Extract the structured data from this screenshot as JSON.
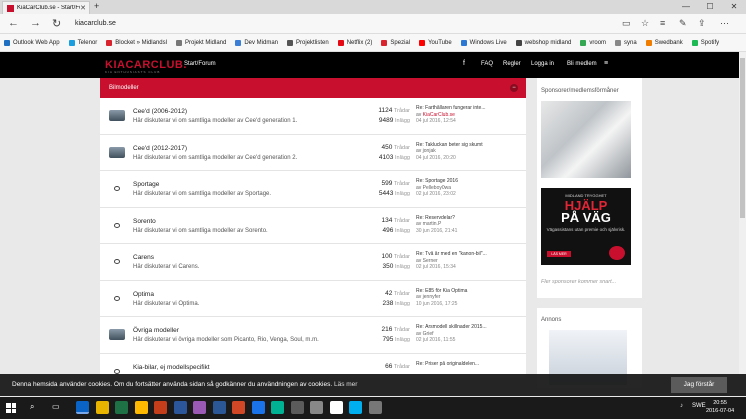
{
  "browser": {
    "tab_title": "KiaCarClub.se - Start/Fo",
    "tab_close": "✕",
    "new_tab": "+",
    "address": "kiacarclub.se",
    "window_controls": [
      "—",
      "☐",
      "✕"
    ],
    "bookmarks": [
      {
        "label": "Outlook Web App",
        "color": "#1f6fc2"
      },
      {
        "label": "Telenor",
        "color": "#1a9ee0"
      },
      {
        "label": "Blocket » Midlandsl",
        "color": "#d9232d"
      },
      {
        "label": "Projekt  Midland",
        "color": "#777777"
      },
      {
        "label": "Dev Midman",
        "color": "#3a7fd5"
      },
      {
        "label": "Projektlisten",
        "color": "#555555"
      },
      {
        "label": "Netflix (2)",
        "color": "#e50914"
      },
      {
        "label": "Spezial",
        "color": "#d9232d"
      },
      {
        "label": "YouTube",
        "color": "#ff0000"
      },
      {
        "label": "Windows Live",
        "color": "#2b78d4"
      },
      {
        "label": "webshop midland",
        "color": "#444444"
      },
      {
        "label": "vroom",
        "color": "#35a853"
      },
      {
        "label": "syna",
        "color": "#888888"
      },
      {
        "label": "Swedbank",
        "color": "#f07c00"
      },
      {
        "label": "Spotify",
        "color": "#1db954"
      }
    ]
  },
  "site": {
    "logo": "KIACARCLUB.",
    "logo_sub": "KIA ENTHUSIASTS CLUB",
    "nav_start": "Start/Forum",
    "nav": {
      "faq": "FAQ",
      "rules": "Regler",
      "login": "Logga in",
      "register": "Bli medlem"
    },
    "icons": {
      "facebook": "f",
      "twitter": "t",
      "menu": "≡"
    }
  },
  "category": {
    "title": "Bilmodeller",
    "collapse": "−"
  },
  "labels": {
    "topics": "Trådar",
    "posts": "Inlägg"
  },
  "forums": [
    {
      "name": "Cee'd (2006-2012)",
      "desc": "Här diskuterar vi om samtliga modeller av Cee'd generation 1.",
      "topics": "1124",
      "posts": "9489",
      "last_title": "Re: Farthållaren fungerar inte...",
      "last_by": "av ",
      "last_user": "KiaCarClub.se",
      "last_date": "04 jul 2016, 12:54",
      "icon": "car"
    },
    {
      "name": "Cee'd (2012-2017)",
      "desc": "Här diskuterar vi om samtliga modeller av Cee'd generation 2.",
      "topics": "450",
      "posts": "4103",
      "last_title": "Re: Takluckan beter sig skumt",
      "last_by": "av jonjak",
      "last_user": "",
      "last_date": "04 jul 2016, 20:20",
      "icon": "car"
    },
    {
      "name": "Sportage",
      "desc": "Här diskuterar vi om samtliga modeller av Sportage.",
      "topics": "599",
      "posts": "5443",
      "last_title": "Re: Sportage 2016",
      "last_by": "av Pelleboy0wa",
      "last_user": "",
      "last_date": "02 jul 2016, 23:02",
      "icon": "bubble"
    },
    {
      "name": "Sorento",
      "desc": "Här diskuterar vi om samtliga modeller av Sorento.",
      "topics": "134",
      "posts": "496",
      "last_title": "Re: Reservdelar?",
      "last_by": "av martin.P",
      "last_user": "",
      "last_date": "30 jun 2016, 21:41",
      "icon": "bubble"
    },
    {
      "name": "Carens",
      "desc": "Här diskuterar vi Carens.",
      "topics": "100",
      "posts": "350",
      "last_title": "Re: Två år med en \"kanon-bil\"...",
      "last_by": "av Serner",
      "last_user": "",
      "last_date": "02 jul 2016, 15:34",
      "icon": "bubble"
    },
    {
      "name": "Optima",
      "desc": "Här diskuterar vi Optima.",
      "topics": "42",
      "posts": "238",
      "last_title": "Re: E85 för Kia Optima",
      "last_by": "av jennyfer",
      "last_user": "",
      "last_date": "10 jun 2016, 17:25",
      "icon": "bubble"
    },
    {
      "name": "Övriga modeller",
      "desc": "Här diskuterar vi övriga modeller som Picanto, Rio, Venga, Soul, m.m.",
      "topics": "216",
      "posts": "795",
      "last_title": "Re: Årsmodell skillnader 2015...",
      "last_by": "av Grief",
      "last_user": "",
      "last_date": "02 jul 2016, 11:55",
      "icon": "car"
    },
    {
      "name": "Kia-bilar, ej modellspecifikt",
      "desc": "",
      "topics": "66",
      "posts": "",
      "last_title": "Re: Priser på originaldelen...",
      "last_by": "",
      "last_user": "",
      "last_date": "",
      "icon": "bubble"
    }
  ],
  "sidebar": {
    "sponsor_title": "Sponsorer/medlemsförmåner",
    "ad_line1": "MIDLAND TRYGGHET",
    "ad_line2": "HJÄLP",
    "ad_line3": "PÅ VÄG",
    "ad_line4": "Vägassistans utan premie och självrisk.",
    "ad_cta": "LÄS MER",
    "more": "Fler sponsorer kommer snart...",
    "annons_title": "Annons"
  },
  "cookie": {
    "text": "Denna hemsida använder cookies. Om du fortsätter använda sidan så godkänner du användningen av cookies.",
    "link": "Läs mer",
    "button": "Jag förstår"
  },
  "taskbar": {
    "lang": "SWE",
    "time": "20:55",
    "date": "2016-07-04",
    "icon_colors": [
      "#0a64c8",
      "#e8b400",
      "#1e7145",
      "#ffb900",
      "#c43e1c",
      "#2b579a",
      "#9b59b6",
      "#2b5797",
      "#d24726",
      "#1a73e8",
      "#00b294",
      "#5b5b5b",
      "#888888",
      "#ffffff",
      "#00aff0",
      "#777777"
    ]
  }
}
